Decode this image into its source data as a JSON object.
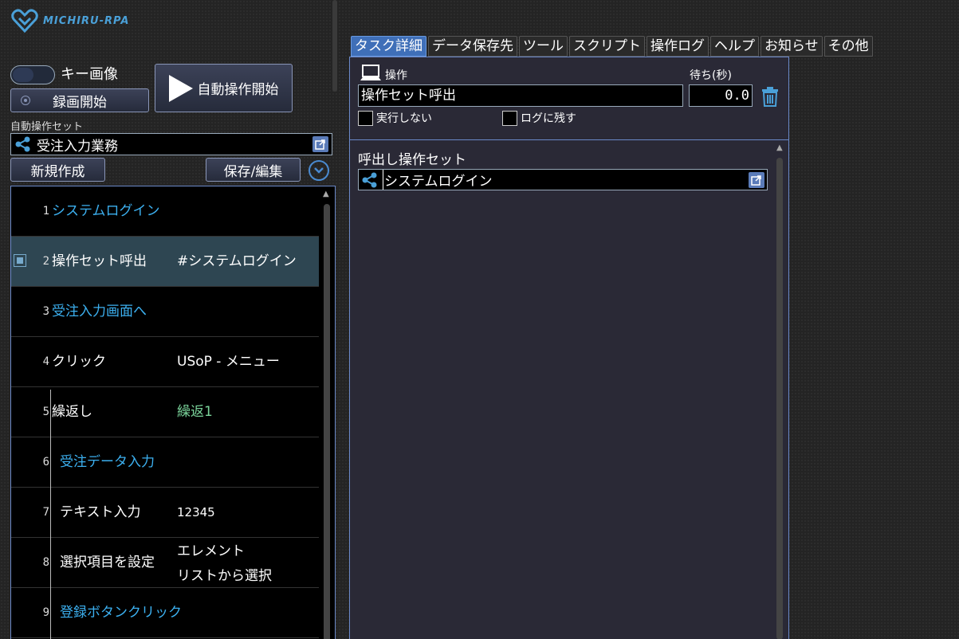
{
  "app": {
    "logo_text": "MICHIRU-RPA"
  },
  "controls": {
    "key_image_label": "キー画像",
    "record_label": "録画開始",
    "auto_start_label": "自動操作開始",
    "set_label": "自動操作セット",
    "set_value": "受注入力業務",
    "new_label": "新規作成",
    "save_label": "保存/編集"
  },
  "tasks": [
    {
      "num": "1",
      "name": "システムログイン",
      "value": ""
    },
    {
      "num": "2",
      "name": "操作セット呼出",
      "value": "#システムログイン"
    },
    {
      "num": "3",
      "name": "受注入力画面へ",
      "value": ""
    },
    {
      "num": "4",
      "name": "クリック",
      "value": "USoP - メニュー"
    },
    {
      "num": "5",
      "name": "繰返し",
      "value": "繰返1"
    },
    {
      "num": "6",
      "name": "受注データ入力",
      "value": ""
    },
    {
      "num": "7",
      "name": "テキスト入力",
      "value": "12345"
    },
    {
      "num": "8",
      "name": "選択項目を設定",
      "value": "エレメント",
      "value2": "リストから選択"
    },
    {
      "num": "9",
      "name": "登録ボタンクリック",
      "value": ""
    }
  ],
  "tabs": [
    "タスク詳細",
    "データ保存先",
    "ツール",
    "スクリプト",
    "操作ログ",
    "ヘルプ",
    "お知らせ",
    "その他"
  ],
  "detail": {
    "op_label": "操作",
    "wait_label": "待ち(秒)",
    "op_value": "操作セット呼出",
    "wait_value": "0.0",
    "no_run_label": "実行しない",
    "log_label": "ログに残す",
    "call_label": "呼出し操作セット",
    "call_value": "システムログイン"
  }
}
